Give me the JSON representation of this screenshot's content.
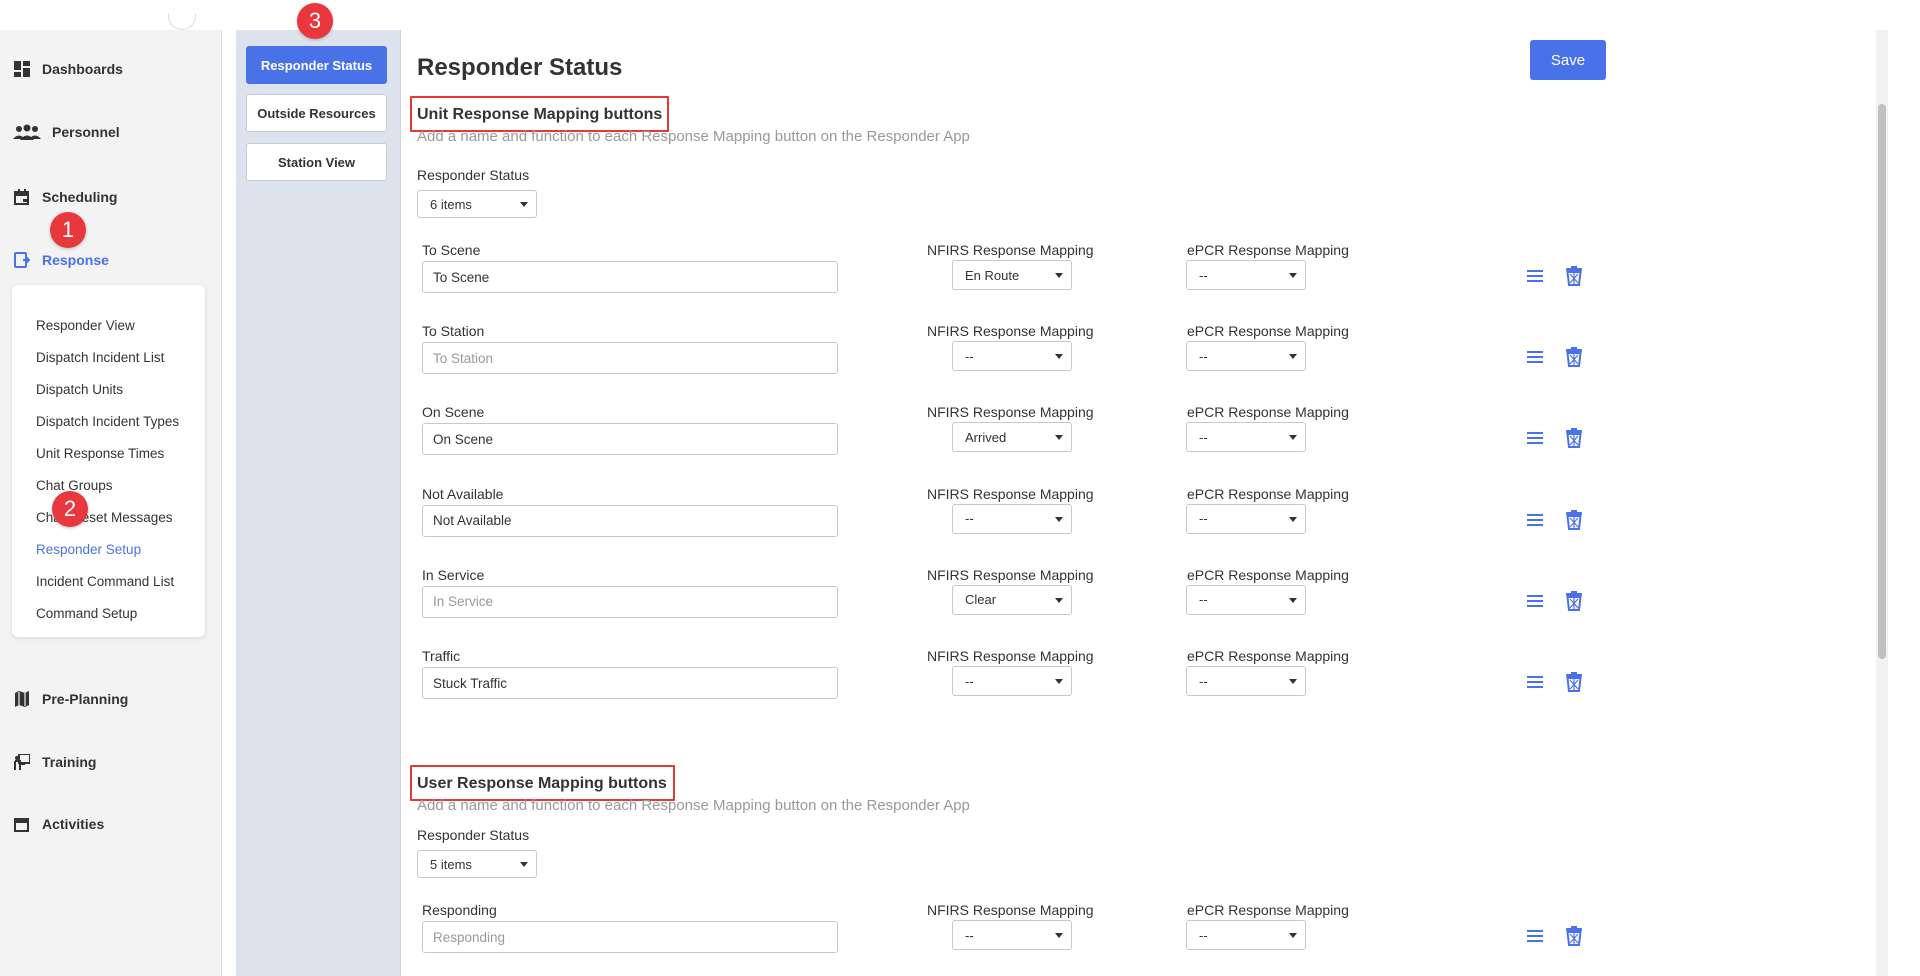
{
  "sidebar": {
    "items": [
      {
        "label": "Dashboards",
        "icon": "dashboard-icon"
      },
      {
        "label": "Personnel",
        "icon": "people-icon"
      },
      {
        "label": "Scheduling",
        "icon": "calendar-icon"
      },
      {
        "label": "Response",
        "icon": "response-icon"
      },
      {
        "label": "Pre-Planning",
        "icon": "map-icon"
      },
      {
        "label": "Training",
        "icon": "training-icon"
      },
      {
        "label": "Activities",
        "icon": "activities-icon"
      }
    ],
    "submenu": [
      "Responder View",
      "Dispatch Incident List",
      "Dispatch Units",
      "Dispatch Incident Types",
      "Unit Response Times",
      "Chat Groups",
      "Chat Preset Messages",
      "Responder Setup",
      "Incident Command List",
      "Command Setup"
    ]
  },
  "subnav": {
    "buttons": [
      "Responder Status",
      "Outside Resources",
      "Station View"
    ]
  },
  "main": {
    "title": "Responder Status",
    "save_label": "Save",
    "unit_section": {
      "title": "Unit Response Mapping buttons",
      "subtitle": "Add a name and function to each Response Mapping button on the Responder App",
      "status_label": "Responder Status",
      "items_value": "6 items",
      "rows": [
        {
          "label": "To Scene",
          "value": "To Scene",
          "placeholder": false,
          "nfirs_label": "NFIRS Response Mapping",
          "nfirs": "En Route",
          "epcr_label": "ePCR Response Mapping",
          "epcr": "--"
        },
        {
          "label": "To Station",
          "value": "To Station",
          "placeholder": true,
          "nfirs_label": "NFIRS Response Mapping",
          "nfirs": "--",
          "epcr_label": "ePCR Response Mapping",
          "epcr": "--"
        },
        {
          "label": "On Scene",
          "value": "On Scene",
          "placeholder": false,
          "nfirs_label": "NFIRS Response Mapping",
          "nfirs": "Arrived",
          "epcr_label": "ePCR Response Mapping",
          "epcr": "--"
        },
        {
          "label": "Not Available",
          "value": "Not Available",
          "placeholder": false,
          "nfirs_label": "NFIRS Response Mapping",
          "nfirs": "--",
          "epcr_label": "ePCR Response Mapping",
          "epcr": "--"
        },
        {
          "label": "In Service",
          "value": "In Service",
          "placeholder": true,
          "nfirs_label": "NFIRS Response Mapping",
          "nfirs": "Clear",
          "epcr_label": "ePCR Response Mapping",
          "epcr": "--"
        },
        {
          "label": "Traffic",
          "value": "Stuck Traffic",
          "placeholder": false,
          "nfirs_label": "NFIRS Response Mapping",
          "nfirs": "--",
          "epcr_label": "ePCR Response Mapping",
          "epcr": "--"
        }
      ]
    },
    "user_section": {
      "title": "User Response Mapping buttons",
      "subtitle": "Add a name and function to each Response Mapping button on the Responder App",
      "status_label": "Responder Status",
      "items_value": "5 items",
      "rows": [
        {
          "label": "Responding",
          "value": "Responding",
          "placeholder": true,
          "nfirs_label": "NFIRS Response Mapping",
          "nfirs": "--",
          "epcr_label": "ePCR Response Mapping",
          "epcr": "--"
        }
      ]
    }
  },
  "markers": [
    "1",
    "2",
    "3"
  ],
  "colors": {
    "accent": "#4a72e8",
    "marker": "#e8383d",
    "highlight_box": "#e53935"
  }
}
